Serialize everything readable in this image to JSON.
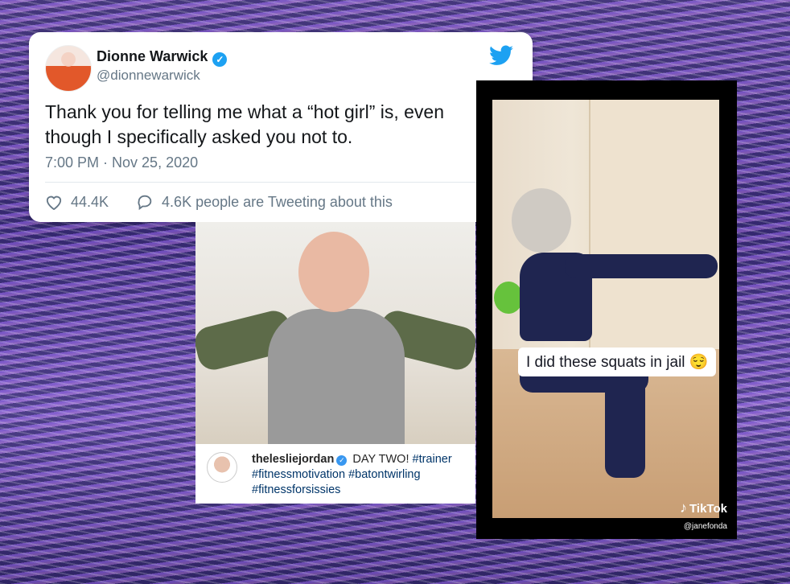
{
  "tweet": {
    "name": "Dionne Warwick",
    "handle": "@dionnewarwick",
    "text": "Thank you for telling me what a “hot girl” is, even though I specifically asked you not to.",
    "timestamp": "7:00 PM · Nov 25, 2020",
    "likes": "44.4K",
    "tweeting": "4.6K people are Tweeting about this",
    "icons": [
      "verified-badge-icon",
      "twitter-bird-icon",
      "heart-icon",
      "speech-bubble-icon"
    ],
    "colors": {
      "brand": "#1da1f2",
      "text": "#14171a",
      "muted": "#657786"
    }
  },
  "instagram": {
    "username": "theleslie jordan",
    "username_display": "thelesliejordan",
    "caption_text": "DAY TWO!",
    "tags": [
      "#trainer",
      "#fitnessmotivation",
      "#batontwirling",
      "#fitnessforsissies"
    ]
  },
  "tiktok": {
    "overlay_text": "I did these squats in jail 😌",
    "logo_label": "TikTok",
    "author": "@janefonda"
  }
}
